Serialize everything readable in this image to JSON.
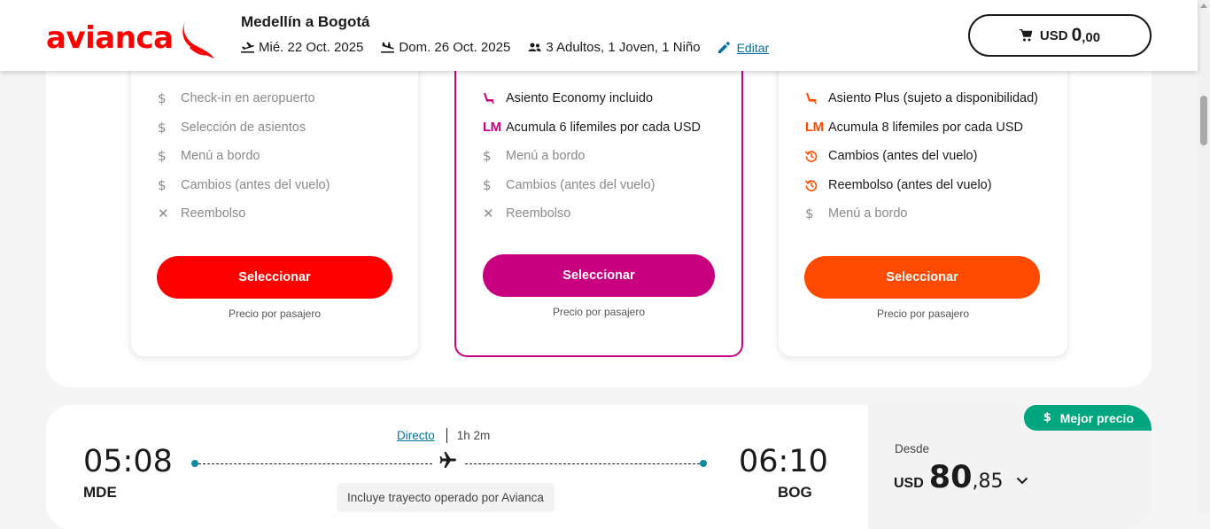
{
  "header": {
    "brand": "avianca",
    "route": "Medellín a Bogotá",
    "departure_date": "Mié. 22 Oct. 2025",
    "return_date": "Dom. 26 Oct. 2025",
    "passengers": "3 Adultos, 1 Joven, 1 Niño",
    "edit_label": "Editar",
    "cart": {
      "currency": "USD",
      "amount_int": "0",
      "amount_dec": ",00"
    }
  },
  "colors": {
    "brand_red": "#ff0000",
    "classic_magenta": "#c8007f",
    "flex_orange": "#ff4a00",
    "link_teal": "#00719c",
    "badge_green": "#00a67e"
  },
  "fares": [
    {
      "id": "basic",
      "button_label": "Seleccionar",
      "price_note": "Precio por pasajero",
      "features": [
        {
          "icon": "dollar-icon",
          "text": "Check-in en aeropuerto",
          "included": false
        },
        {
          "icon": "dollar-icon",
          "text": "Selección de asientos",
          "included": false
        },
        {
          "icon": "dollar-icon",
          "text": "Menú a bordo",
          "included": false
        },
        {
          "icon": "dollar-icon",
          "text": "Cambios (antes del vuelo)",
          "included": false
        },
        {
          "icon": "cross-icon",
          "text": "Reembolso",
          "included": false
        }
      ]
    },
    {
      "id": "classic",
      "button_label": "Seleccionar",
      "price_note": "Precio por pasajero",
      "features": [
        {
          "icon": "seat-icon",
          "text": "Asiento Economy incluido",
          "included": true
        },
        {
          "icon": "lifemiles-icon",
          "icon_text": "LM",
          "text": "Acumula 6 lifemiles por cada USD",
          "included": true
        },
        {
          "icon": "dollar-icon",
          "text": "Menú a bordo",
          "included": false
        },
        {
          "icon": "dollar-icon",
          "text": "Cambios (antes del vuelo)",
          "included": false
        },
        {
          "icon": "cross-icon",
          "text": "Reembolso",
          "included": false
        }
      ]
    },
    {
      "id": "flex",
      "button_label": "Seleccionar",
      "price_note": "Precio por pasajero",
      "features": [
        {
          "icon": "seat-icon",
          "text": "Asiento Plus (sujeto a disponibilidad)",
          "included": true
        },
        {
          "icon": "lifemiles-icon",
          "icon_text": "LM",
          "text": "Acumula 8 lifemiles por cada USD",
          "included": true
        },
        {
          "icon": "history-icon",
          "text": "Cambios (antes del vuelo)",
          "included": true
        },
        {
          "icon": "history-icon",
          "text": "Reembolso (antes del vuelo)",
          "included": true
        },
        {
          "icon": "dollar-icon",
          "text": "Menú a bordo",
          "included": false
        }
      ]
    }
  ],
  "flight": {
    "departure_time": "05:08",
    "departure_code": "MDE",
    "arrival_time": "06:10",
    "arrival_code": "BOG",
    "type_label": "Directo",
    "duration": "1h 2m",
    "operated_by": "Incluye trayecto operado por Avianca",
    "badge": "Mejor precio",
    "from_label": "Desde",
    "price": {
      "currency": "USD",
      "int": "80",
      "dec": ",85"
    }
  }
}
